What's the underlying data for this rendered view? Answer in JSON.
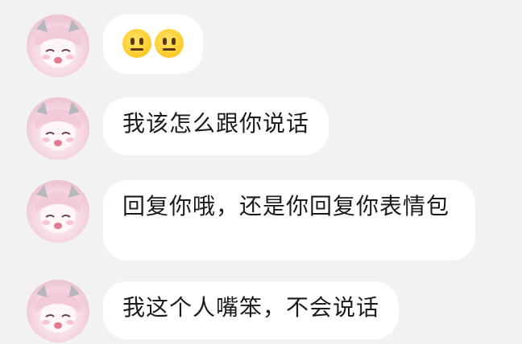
{
  "conversation": {
    "messages": [
      {
        "type": "emoji",
        "emoji": [
          "😐",
          "😐"
        ],
        "emoji_icon": "neutral-face-icon"
      },
      {
        "type": "text",
        "text": "我该怎么跟你说话"
      },
      {
        "type": "text",
        "text": "回复你哦，还是你回复你表情包"
      },
      {
        "type": "text",
        "text": "我这个人嘴笨，不会说话"
      }
    ]
  },
  "colors": {
    "background": "#f2f2f5",
    "bubble": "#ffffff",
    "text": "#1b1b1b",
    "emoji": "#ffcf2f"
  }
}
